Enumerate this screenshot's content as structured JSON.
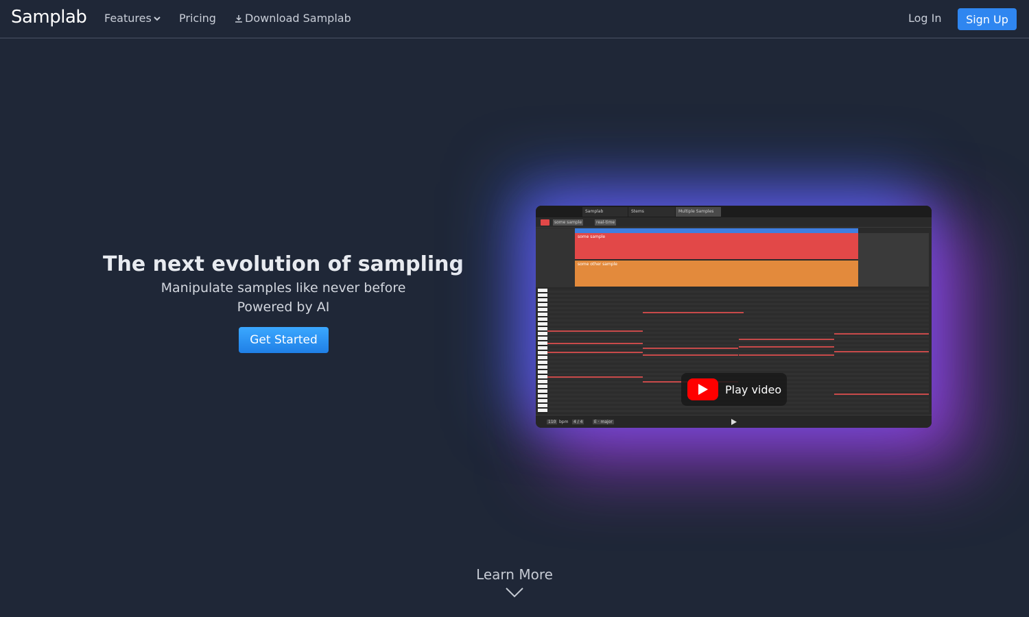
{
  "nav": {
    "logo": "Samplab",
    "features": "Features",
    "pricing": "Pricing",
    "download": "Download Samplab",
    "login": "Log In",
    "signup": "Sign Up"
  },
  "hero": {
    "title": "The next evolution of sampling",
    "subtitle1": "Manipulate samples like never before",
    "subtitle2": "Powered by AI",
    "cta": "Get Started"
  },
  "video": {
    "play_label": "Play video",
    "tabs": [
      "Samplab",
      "Stems",
      "Multiple Samples"
    ],
    "clip1": "some sample",
    "clip2": "some other sample",
    "tool_sample": "some sample",
    "tool_mode": "real-time",
    "bpm": "110",
    "bpm_unit": "bpm",
    "time_sig": "4 / 4",
    "key": "E · major"
  },
  "learn_more": "Learn More",
  "colors": {
    "background": "#1f2737",
    "accent": "#2f86f0"
  }
}
